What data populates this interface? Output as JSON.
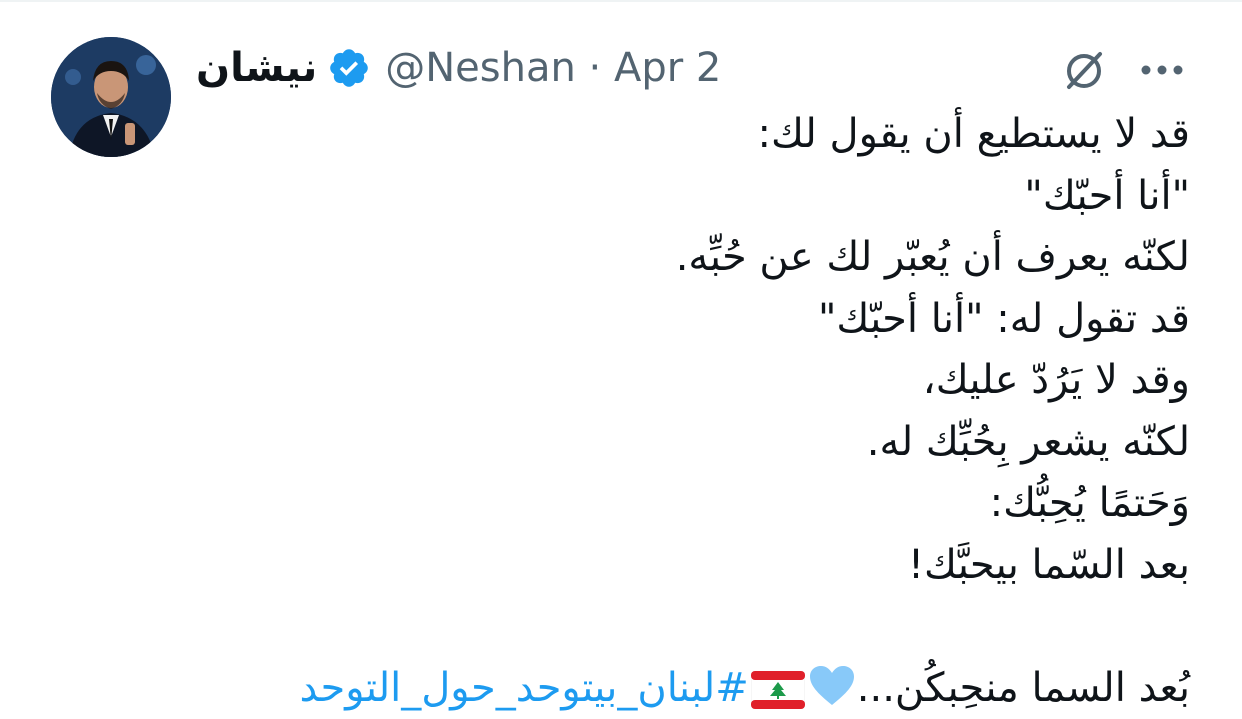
{
  "author": {
    "display_name": "نيشان",
    "handle_meta": "@Neshan · Apr 2",
    "verified_icon": "verified-badge-icon"
  },
  "actions": {
    "grok_icon": "grok-icon",
    "more_icon": "more-dots-icon"
  },
  "tweet": {
    "lines": [
      "قد لا يستطيع أن يقول لك:",
      "\"أنا أحبّك\"",
      "لكنّه يعرف أن يُعبّر لك عن حُبِّه.",
      "قد تقول له: \"أنا أحبّك\"",
      "وقد لا يَرُدّ عليك،",
      "لكنّه يشعر بِحُبِّك له.",
      "وَحَتمًا يُحِبُّك:",
      "بعد السّما بيحبَّك!"
    ],
    "last_line_text": "بُعد السما منحِبكُن...",
    "hashtag": "#لبنان_بيتوحد_حول_التوحد",
    "emoji_heart": "light-blue-heart-icon",
    "emoji_flag": "lebanon-flag-icon"
  },
  "colors": {
    "link": "#1d9bf0",
    "secondary_text": "#536471",
    "primary_text": "#0f1419",
    "verified": "#1d9bf0"
  }
}
